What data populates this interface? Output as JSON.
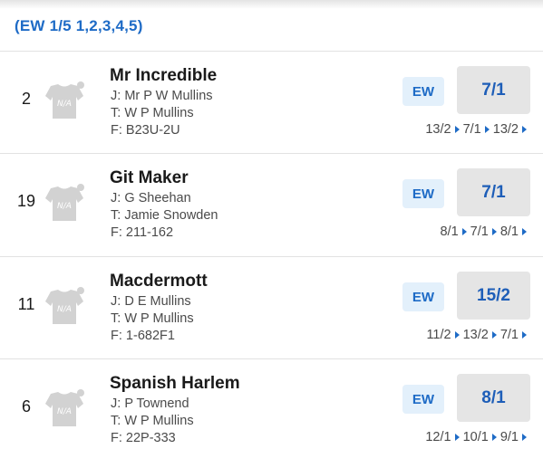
{
  "ew_terms": "(EW 1/5 1,2,3,4,5)",
  "silk_placeholder": "N/A",
  "labels": {
    "jockey": "J:",
    "trainer": "T:",
    "form": "F:",
    "ew": "EW"
  },
  "colors": {
    "accent": "#1e6bc6",
    "odds_button_bg": "#e5e5e5",
    "ew_badge_bg": "#e3f0fb",
    "silk": "#d2d2d2"
  },
  "icons": {
    "silk": "silk-placeholder-icon",
    "arrow": "triangle-right-icon"
  },
  "runners": [
    {
      "number": "2",
      "name": "Mr Incredible",
      "jockey": "Mr P W Mullins",
      "trainer": "W P Mullins",
      "form": "B23U-2U",
      "odds": "7/1",
      "history": [
        "13/2",
        "7/1",
        "13/2"
      ]
    },
    {
      "number": "19",
      "name": "Git Maker",
      "jockey": "G Sheehan",
      "trainer": "Jamie Snowden",
      "form": "211-162",
      "odds": "7/1",
      "history": [
        "8/1",
        "7/1",
        "8/1"
      ]
    },
    {
      "number": "11",
      "name": "Macdermott",
      "jockey": "D E Mullins",
      "trainer": "W P Mullins",
      "form": "1-682F1",
      "odds": "15/2",
      "history": [
        "11/2",
        "13/2",
        "7/1"
      ]
    },
    {
      "number": "6",
      "name": "Spanish Harlem",
      "jockey": "P Townend",
      "trainer": "W P Mullins",
      "form": "22P-333",
      "odds": "8/1",
      "history": [
        "12/1",
        "10/1",
        "9/1"
      ]
    }
  ]
}
